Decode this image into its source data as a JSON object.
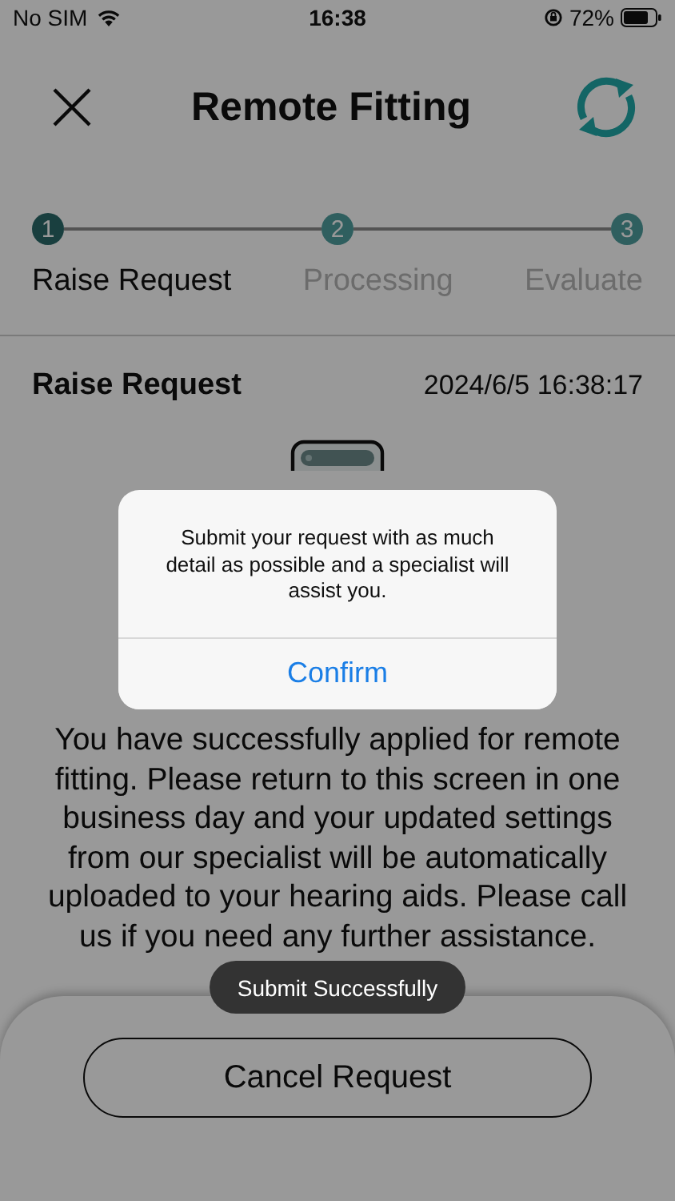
{
  "status_bar": {
    "carrier": "No SIM",
    "time": "16:38",
    "battery": "72%"
  },
  "header": {
    "title": "Remote Fitting"
  },
  "steps": [
    {
      "number": "1",
      "label": "Raise Request",
      "selected": true
    },
    {
      "number": "2",
      "label": "Processing",
      "selected": false
    },
    {
      "number": "3",
      "label": "Evaluate",
      "selected": false
    }
  ],
  "request": {
    "title": "Raise Request",
    "timestamp": "2024/6/5 16:38:17",
    "message": "You have successfully applied for remote fitting. Please return to this screen in one business day and your updated settings from our specialist will be automatically uploaded to your hearing aids. Please call us if you need any further assistance."
  },
  "bottom_button": "Cancel Request",
  "dialog": {
    "message": "Submit your request with as much detail as possible and a specialist will assist you.",
    "button": "Confirm"
  },
  "toast": "Submit Successfully"
}
